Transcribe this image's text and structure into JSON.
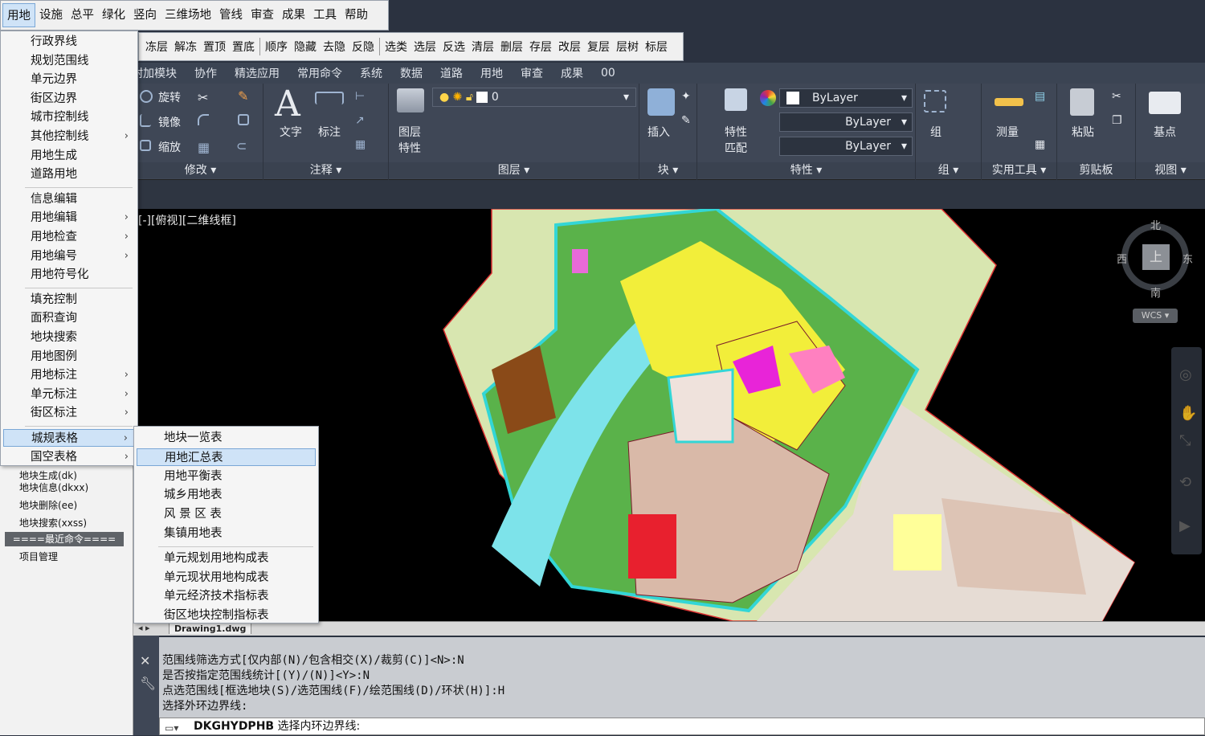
{
  "menubar": [
    "用地",
    "设施",
    "总平",
    "绿化",
    "竖向",
    "三维场地",
    "管线",
    "审查",
    "成果",
    "工具",
    "帮助"
  ],
  "toolstrip": [
    "冻层",
    "解冻",
    "置顶",
    "置底",
    "顺序",
    "隐藏",
    "去隐",
    "反隐",
    "选类",
    "选层",
    "反选",
    "清层",
    "删层",
    "存层",
    "改层",
    "复层",
    "层树",
    "标层"
  ],
  "ribbon_tabs": [
    "附加模块",
    "协作",
    "精选应用",
    "常用命令",
    "系统",
    "数据",
    "道路",
    "用地",
    "审查",
    "成果",
    "00"
  ],
  "ribbon": {
    "modify": {
      "rotate": "旋转",
      "mirror": "镜像",
      "scale": "缩放",
      "title": "修改"
    },
    "annotate": {
      "text": "文字",
      "dim": "标注",
      "title": "注释"
    },
    "layers": {
      "layer_props": "图层",
      "layer_props2": "特性",
      "current_layer": "0",
      "title": "图层"
    },
    "block": {
      "insert": "插入",
      "title": "块"
    },
    "props": {
      "match": "特性",
      "match2": "匹配",
      "color": "ByLayer",
      "linetype": "ByLayer",
      "lineweight": "ByLayer",
      "title": "特性"
    },
    "group": {
      "group": "组",
      "title": "组"
    },
    "utilities": {
      "measure": "测量",
      "title": "实用工具"
    },
    "clipboard": {
      "paste": "粘贴",
      "title": "剪贴板"
    },
    "view": {
      "basepoint": "基点",
      "title": "视图"
    }
  },
  "viewport_label": "[-][俯视][二维线框]",
  "compass": {
    "n": "北",
    "s": "南",
    "e": "东",
    "w": "西",
    "top": "上",
    "wcs": "WCS"
  },
  "menu1": {
    "items": [
      {
        "label": "行政界线",
        "sub": false
      },
      {
        "label": "规划范围线",
        "sub": false
      },
      {
        "label": "单元边界",
        "sub": false
      },
      {
        "label": "街区边界",
        "sub": false
      },
      {
        "label": "城市控制线",
        "sub": false
      },
      {
        "label": "其他控制线",
        "sub": true
      },
      {
        "label": "用地生成",
        "sub": false
      },
      {
        "label": "道路用地",
        "sub": false
      },
      {
        "label": "信息编辑",
        "sub": false
      },
      {
        "label": "用地编辑",
        "sub": true
      },
      {
        "label": "用地检查",
        "sub": true
      },
      {
        "label": "用地编号",
        "sub": true
      },
      {
        "label": "用地符号化",
        "sub": false
      },
      {
        "label": "填充控制",
        "sub": false
      },
      {
        "label": "面积查询",
        "sub": false
      },
      {
        "label": "地块搜索",
        "sub": false
      },
      {
        "label": "用地图例",
        "sub": false
      },
      {
        "label": "用地标注",
        "sub": true
      },
      {
        "label": "单元标注",
        "sub": true
      },
      {
        "label": "街区标注",
        "sub": true
      },
      {
        "label": "城规表格",
        "sub": true
      },
      {
        "label": "国空表格",
        "sub": true
      }
    ]
  },
  "menu2": {
    "items": [
      "地块一览表",
      "用地汇总表",
      "用地平衡表",
      "城乡用地表",
      "风 景 区 表",
      "集镇用地表",
      "单元规划用地构成表",
      "单元现状用地构成表",
      "单元经济技术指标表",
      "街区地块控制指标表"
    ]
  },
  "sidepanel": {
    "commands": [
      "地块生成(dk)",
      "地块信息(dkxx)",
      "地块删除(ee)",
      "地块搜索(xxss)"
    ],
    "recent": "====最近命令====",
    "project": "项目管理"
  },
  "drawing_tab": "Drawing1.dwg",
  "command_history": [
    "范围线筛选方式[仅内部(N)/包含相交(X)/裁剪(C)]<N>:N",
    "是否按指定范围线统计[(Y)/(N)]<Y>:N",
    "点选范围线[框选地块(S)/选范围线(F)/绘范围线(D)/环状(H)]:H",
    "选择外环边界线:"
  ],
  "command_prompt": {
    "cmd": "DKGHYDPHB",
    "text": "选择内环边界线:"
  }
}
